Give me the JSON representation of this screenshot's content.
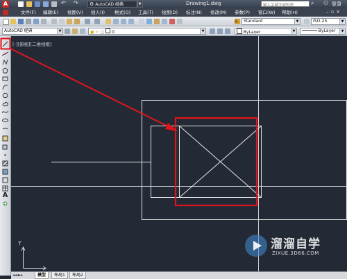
{
  "title_bar": {
    "workspace": "AutoCAD 经典",
    "document_title": "Drawing1.dwg",
    "search_placeholder": "键入关键字或短语",
    "login_label": "登录"
  },
  "menu": [
    {
      "label": "文件(F)"
    },
    {
      "label": "编辑(E)"
    },
    {
      "label": "视图(V)"
    },
    {
      "label": "插入(I)"
    },
    {
      "label": "格式(O)"
    },
    {
      "label": "工具(T)"
    },
    {
      "label": "绘图(D)"
    },
    {
      "label": "标注(N)"
    },
    {
      "label": "修改(M)"
    },
    {
      "label": "参数(P)"
    },
    {
      "label": "窗口(W)"
    },
    {
      "label": "帮助(H)"
    }
  ],
  "toolbar1": {
    "text_style": "Standard",
    "dim_style": "ISO-25"
  },
  "toolbar2": {
    "workspace": "AutoCAD 经典",
    "layer": "0",
    "color": "ByLayer",
    "linetype": "ByLayer"
  },
  "viewport_label": "[-][俯视][二维线框]",
  "ucs": {
    "y_label": "Y"
  },
  "tabs": [
    {
      "label": "模型"
    },
    {
      "label": "布局1"
    },
    {
      "label": "布局2"
    }
  ],
  "watermark": {
    "name": "溜溜自学",
    "url": "ZIXUE.3D66.COM"
  },
  "colors": {
    "highlight": "#e0141e",
    "canvas": "#242a35",
    "geometry": "#e6e6e6"
  },
  "icons": [
    "line-icon",
    "construction-line-icon",
    "polyline-icon",
    "polygon-icon",
    "rectangle-icon",
    "arc-icon",
    "circle-icon",
    "revision-cloud-icon",
    "spline-icon",
    "ellipse-icon",
    "insert-block-icon",
    "point-icon",
    "hatch-icon",
    "table-icon",
    "text-icon",
    "add-selected-icon"
  ]
}
